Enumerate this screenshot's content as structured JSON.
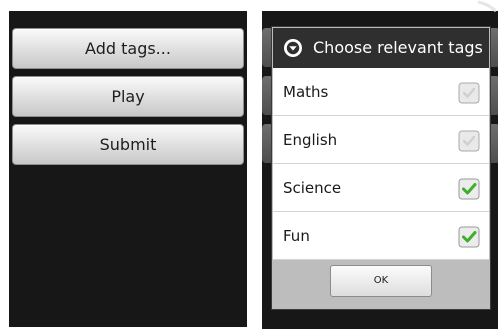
{
  "main_screen": {
    "buttons": [
      {
        "label": "Add tags..."
      },
      {
        "label": "Play"
      },
      {
        "label": "Submit"
      }
    ]
  },
  "dialog": {
    "title": "Choose relevant tags",
    "title_icon": "chevron-down-circle-icon",
    "items": [
      {
        "label": "Maths",
        "checked": false
      },
      {
        "label": "English",
        "checked": false
      },
      {
        "label": "Science",
        "checked": true
      },
      {
        "label": "Fun",
        "checked": true
      }
    ],
    "ok_label": "OK"
  },
  "colors": {
    "screen_background": "#171717",
    "dialog_title_bar": "#2f2f2f",
    "check_green": "#3fae2a",
    "footer": "#bdbdbd"
  }
}
